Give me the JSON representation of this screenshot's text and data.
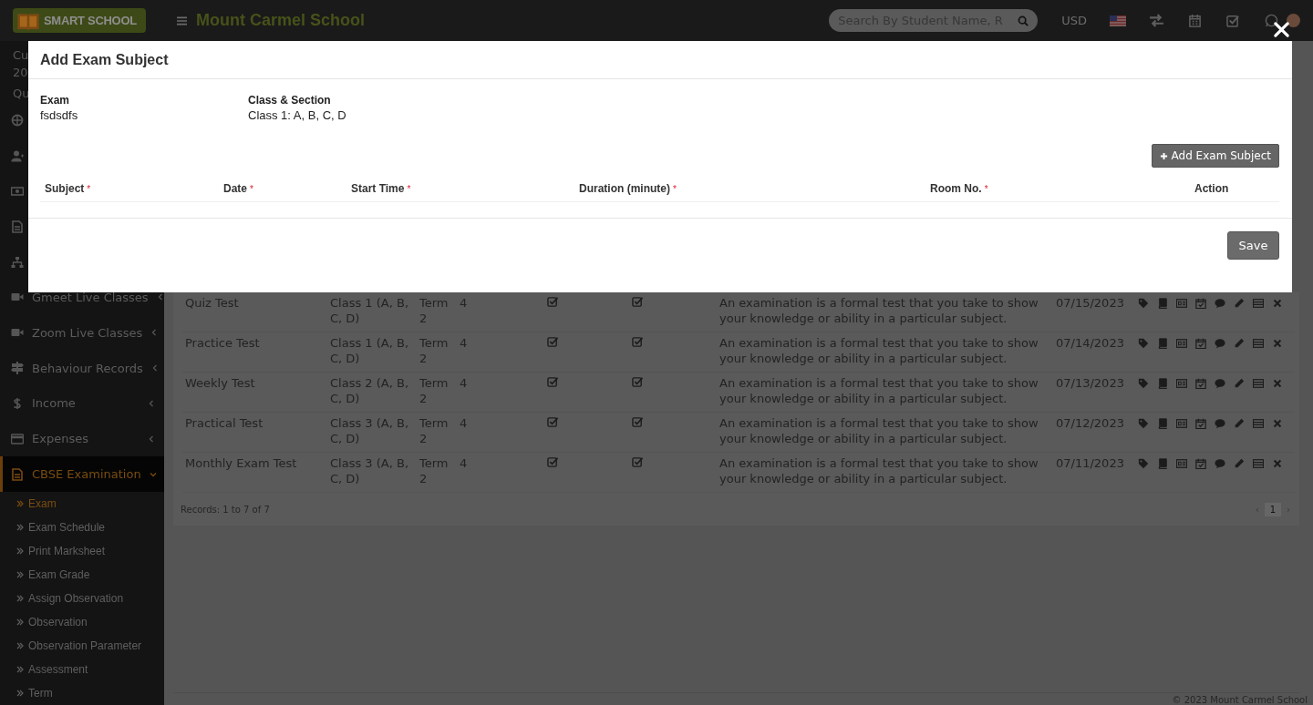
{
  "topbar": {
    "logo_text": "SMART SCHOOL",
    "title": "Mount Carmel School",
    "search": {
      "placeholder": "Search By Student Name, R"
    },
    "currency": "USD"
  },
  "sidebar": {
    "session_lines": [
      "Cu",
      "20",
      "Qu"
    ],
    "menu": [
      {
        "label": "Gmeet Live Classes",
        "selected": false,
        "expanded": false
      },
      {
        "label": "Zoom Live Classes",
        "selected": false,
        "expanded": false
      },
      {
        "label": "Behaviour Records",
        "selected": false,
        "expanded": false
      },
      {
        "label": "Income",
        "selected": false,
        "expanded": false
      },
      {
        "label": "Expenses",
        "selected": false,
        "expanded": false
      },
      {
        "label": "CBSE Examination",
        "selected": true,
        "expanded": true,
        "children": [
          {
            "label": "Exam",
            "selected": true
          },
          {
            "label": "Exam Schedule",
            "selected": false
          },
          {
            "label": "Print Marksheet",
            "selected": false
          },
          {
            "label": "Exam Grade",
            "selected": false
          },
          {
            "label": "Assign Observation",
            "selected": false
          },
          {
            "label": "Observation",
            "selected": false
          },
          {
            "label": "Observation Parameter",
            "selected": false
          },
          {
            "label": "Assessment",
            "selected": false
          },
          {
            "label": "Term",
            "selected": false
          }
        ]
      }
    ]
  },
  "table": {
    "rows": [
      {
        "name": "Quiz Test",
        "class_section": "Class 1 (A, B, C, D)",
        "term": "Term 2",
        "column_4": "4",
        "checks": [
          {
            "checked": true
          },
          {
            "checked": true
          }
        ],
        "description": "An examination is a formal test that you take to show your knowledge or ability in a particular subject.",
        "date": "07/15/2023"
      },
      {
        "name": "Practice Test",
        "class_section": "Class 1 (A, B, C, D)",
        "term": "Term 2",
        "column_4": "4",
        "checks": [
          {
            "checked": true
          },
          {
            "checked": true
          }
        ],
        "description": "An examination is a formal test that you take to show your knowledge or ability in a particular subject.",
        "date": "07/14/2023"
      },
      {
        "name": "Weekly Test",
        "class_section": "Class 2 (A, B, C, D)",
        "term": "Term 2",
        "column_4": "4",
        "checks": [
          {
            "checked": true
          },
          {
            "checked": true
          }
        ],
        "description": "An examination is a formal test that you take to show your knowledge or ability in a particular subject.",
        "date": "07/13/2023"
      },
      {
        "name": "Practical Test",
        "class_section": "Class 3 (A, B, C, D)",
        "term": "Term 2",
        "column_4": "4",
        "checks": [
          {
            "checked": true
          },
          {
            "checked": true
          }
        ],
        "description": "An examination is a formal test that you take to show your knowledge or ability in a particular subject.",
        "date": "07/12/2023"
      },
      {
        "name": "Monthly Exam Test",
        "class_section": "Class 3 (A, B, C, D)",
        "term": "Term 2",
        "column_4": "4",
        "checks": [
          {
            "checked": true
          },
          {
            "checked": true
          }
        ],
        "description": "An examination is a formal test that you take to show your knowledge or ability in a particular subject.",
        "date": "07/11/2023"
      }
    ],
    "records": "Records: 1 to 7 of 7",
    "pagination": {
      "prev": "‹",
      "pages": [
        {
          "label": "1",
          "selected": true
        }
      ],
      "next": "›"
    }
  },
  "footer": "© 2023 Mount Carmel School",
  "modal": {
    "title": "Add Exam Subject",
    "fields": [
      {
        "label": "Exam",
        "value": "fsdsdfs"
      },
      {
        "label": "Class & Section",
        "value": "Class 1: A, B, C, D"
      }
    ],
    "add_button": "Add Exam Subject",
    "required_mark": "*",
    "columns": [
      {
        "label": "Subject",
        "required": true
      },
      {
        "label": "Date",
        "required": true
      },
      {
        "label": "Start Time",
        "required": true
      },
      {
        "label": "Duration (minute)",
        "required": true
      },
      {
        "label": "Room No.",
        "required": true
      },
      {
        "label": "Action",
        "required": false
      }
    ],
    "save_button": "Save"
  }
}
